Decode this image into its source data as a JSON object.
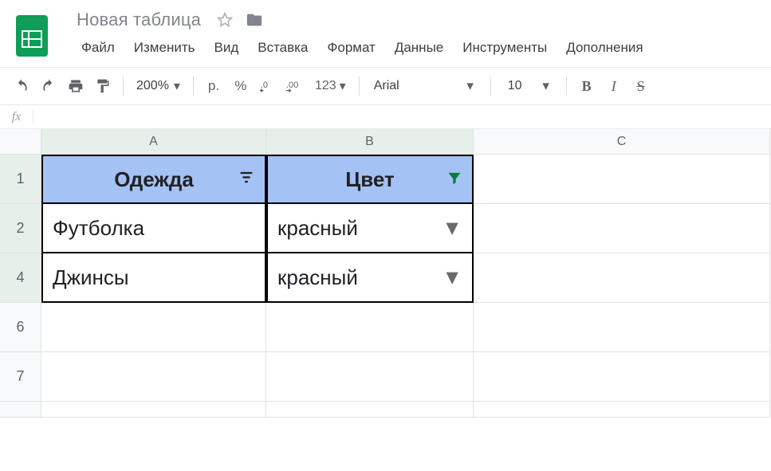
{
  "doc": {
    "title": "Новая таблица"
  },
  "menu": {
    "file": "Файл",
    "edit": "Изменить",
    "view": "Вид",
    "insert": "Вставка",
    "format": "Формат",
    "data": "Данные",
    "tools": "Инструменты",
    "addons": "Дополнения"
  },
  "toolbar": {
    "zoom": "200%",
    "currency": "р.",
    "percent": "%",
    "dec_dec": ".0",
    "dec_inc": ".00",
    "num_format": "123",
    "font_name": "Arial",
    "font_size": "10",
    "bold": "B",
    "italic": "I",
    "strike": "S"
  },
  "formula_bar": {
    "fx": "fx",
    "value": ""
  },
  "grid": {
    "columns": [
      "A",
      "B",
      "C"
    ],
    "active_columns": [
      "A",
      "B"
    ],
    "header_row_label": "1",
    "headers": {
      "c1": "Одежда",
      "c2": "Цвет"
    },
    "rows": [
      {
        "label": "2",
        "c1": "Футболка",
        "c2": "красный"
      },
      {
        "label": "4",
        "c1": "Джинсы",
        "c2": "красный"
      }
    ],
    "empty_row_labels": [
      "6",
      "7"
    ]
  }
}
